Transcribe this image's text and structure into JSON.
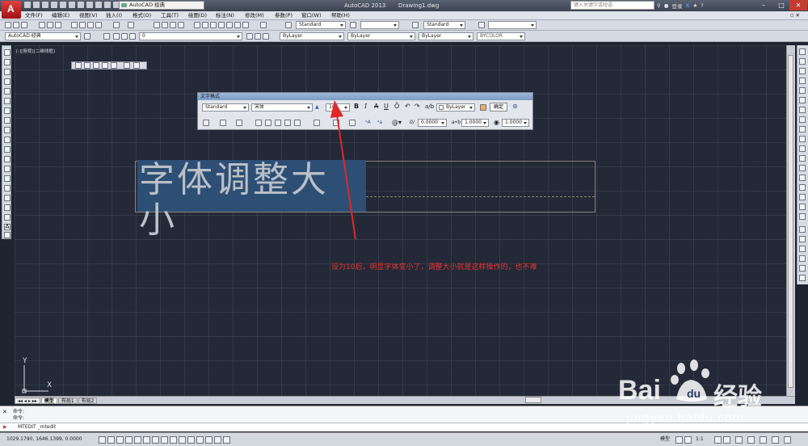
{
  "titlebar": {
    "workspace": "AutoCAD 经典",
    "app_title": "AutoCAD 2013",
    "drawing_name": "Drawing1.dwg",
    "search_placeholder": "键入关键字或短语",
    "login_label": "登录"
  },
  "menubar": {
    "items": [
      "文件(F)",
      "编辑(E)",
      "视图(V)",
      "插入(I)",
      "格式(O)",
      "工具(T)",
      "绘图(D)",
      "标注(N)",
      "修改(M)",
      "参数(P)",
      "窗口(W)",
      "帮助(H)"
    ]
  },
  "toolbar2": {
    "text_style": "Standard",
    "table_style": "Standard"
  },
  "toolbar3": {
    "workspace": "AutoCAD 经典",
    "layer": "0",
    "color": "ByLayer",
    "linetype": "ByLayer",
    "lineweight": "ByLayer",
    "plotstyle": "BYCOLOR"
  },
  "viewport_label": "[-][俯视][二维线框]",
  "text_format": {
    "title": "文字格式",
    "style": "Standard",
    "font": "宋体",
    "height": "10",
    "bold": "B",
    "italic": "I",
    "strike": "A",
    "underline": "U",
    "overline": "Ō",
    "color": "ByLayer",
    "ok": "确定",
    "oblique": "0.0000",
    "tracking": "1.0000",
    "width_factor": "1.0000"
  },
  "mtext_content": "字体调整大小",
  "annotation": "设为10后，明显字体变小了，调整大小就是这样操作的，也不难",
  "ucs": {
    "y": "Y",
    "x": "X"
  },
  "layout_tabs": [
    "模型",
    "布局1",
    "布局2"
  ],
  "command": {
    "line1": "命令:",
    "line2": "命令:",
    "current": "MTEDIT _mtedit"
  },
  "status": {
    "coords": "1029.1790, 1646.1399, 0.0000",
    "model": "模型",
    "scale": "1:1"
  },
  "watermark": {
    "brand_a": "Bai",
    "brand_b": "经验",
    "url": "jingyan.baidu.com"
  }
}
